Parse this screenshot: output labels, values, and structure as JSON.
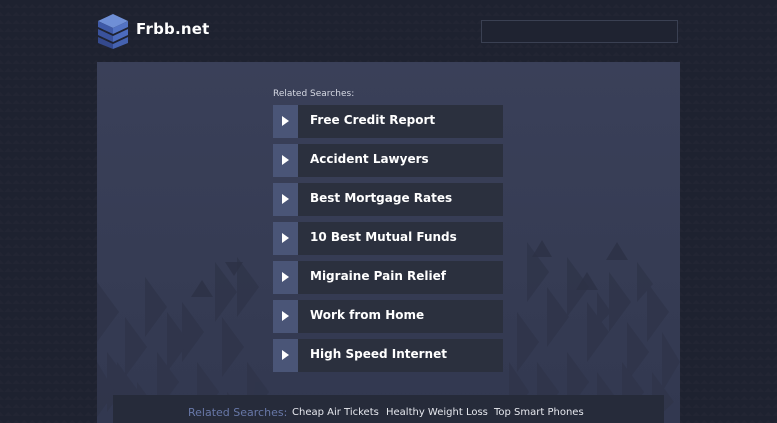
{
  "header": {
    "logo_icon": "stacked-layers-icon",
    "site_name": "Frbb.net",
    "search_value": ""
  },
  "main": {
    "related_label": "Related Searches:",
    "links": [
      {
        "label": "Free Credit Report"
      },
      {
        "label": "Accident Lawyers"
      },
      {
        "label": "Best Mortgage Rates"
      },
      {
        "label": "10 Best Mutual Funds"
      },
      {
        "label": "Migraine Pain Relief"
      },
      {
        "label": "Work from Home"
      },
      {
        "label": "High Speed Internet"
      }
    ],
    "link_arrow_icon": "play-arrow-icon"
  },
  "footer": {
    "label": "Related Searches:",
    "links": [
      {
        "label": "Cheap Air Tickets"
      },
      {
        "label": "Healthy Weight Loss"
      },
      {
        "label": "Top Smart Phones"
      }
    ]
  },
  "colors": {
    "page_bg": "#1e2230",
    "panel_bg": "#3a4059",
    "link_bg": "#2b303e",
    "arrow_bg": "#4a5577",
    "footer_label": "#6878a8"
  }
}
